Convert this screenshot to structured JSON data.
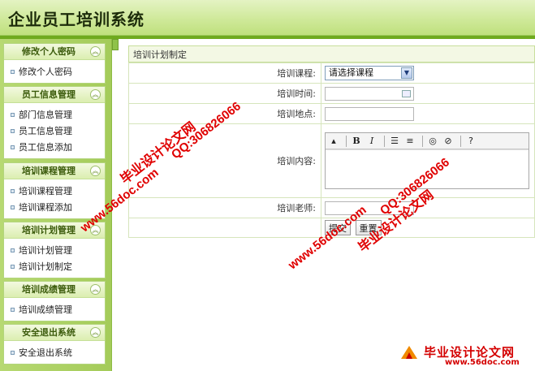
{
  "app": {
    "title": "企业员工培训系统"
  },
  "sidebar": {
    "panels": [
      {
        "title": "修改个人密码",
        "items": [
          "修改个人密码"
        ]
      },
      {
        "title": "员工信息管理",
        "items": [
          "部门信息管理",
          "员工信息管理",
          "员工信息添加"
        ]
      },
      {
        "title": "培训课程管理",
        "items": [
          "培训课程管理",
          "培训课程添加"
        ]
      },
      {
        "title": "培训计划管理",
        "items": [
          "培训计划管理",
          "培训计划制定"
        ]
      },
      {
        "title": "培训成绩管理",
        "items": [
          "培训成绩管理"
        ]
      },
      {
        "title": "安全退出系统",
        "items": [
          "安全退出系统"
        ]
      }
    ]
  },
  "main": {
    "title": "培训计划制定",
    "form": {
      "course_label": "培训课程:",
      "course_value": "请选择课程",
      "time_label": "培训时间:",
      "place_label": "培训地点:",
      "content_label": "培训内容:",
      "teacher_label": "培训老师:",
      "submit_label": "提交",
      "reset_label": "重置"
    },
    "editor_toolbar": {
      "bold": "B",
      "italic": "I"
    }
  },
  "watermarks": {
    "left_site": "www.56doc.com",
    "left_brand": "毕业设计论文网",
    "left_qq": "QQ:306826066",
    "center_site": "www.56doc.com",
    "center_brand": "毕业设计论文网",
    "center_qq": "QQ:306826066",
    "corner_brand": "毕业设计论文网",
    "corner_site": "www.56doc.com"
  }
}
